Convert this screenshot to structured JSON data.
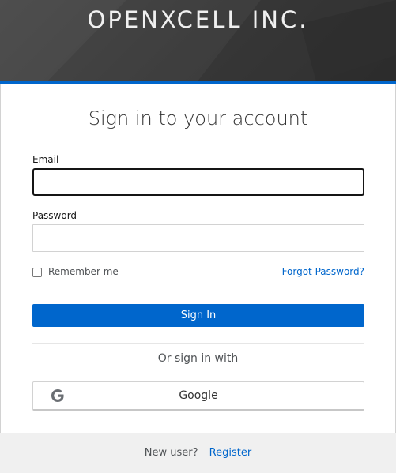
{
  "header": {
    "brand": "OPENXCELL INC."
  },
  "login": {
    "title": "Sign in to your account",
    "email_label": "Email",
    "email_value": "",
    "password_label": "Password",
    "password_value": "",
    "remember_label": "Remember me",
    "remember_checked": false,
    "forgot_label": "Forgot Password?",
    "signin_label": "Sign In",
    "or_label": "Or sign in with",
    "google_label": "Google"
  },
  "footer": {
    "new_user_label": "New user?",
    "register_label": "Register"
  },
  "colors": {
    "accent": "#0066cc",
    "header_bg": "#3b3b3b",
    "footer_bg": "#f0f0f0"
  },
  "icons": {
    "google": "google-icon"
  }
}
